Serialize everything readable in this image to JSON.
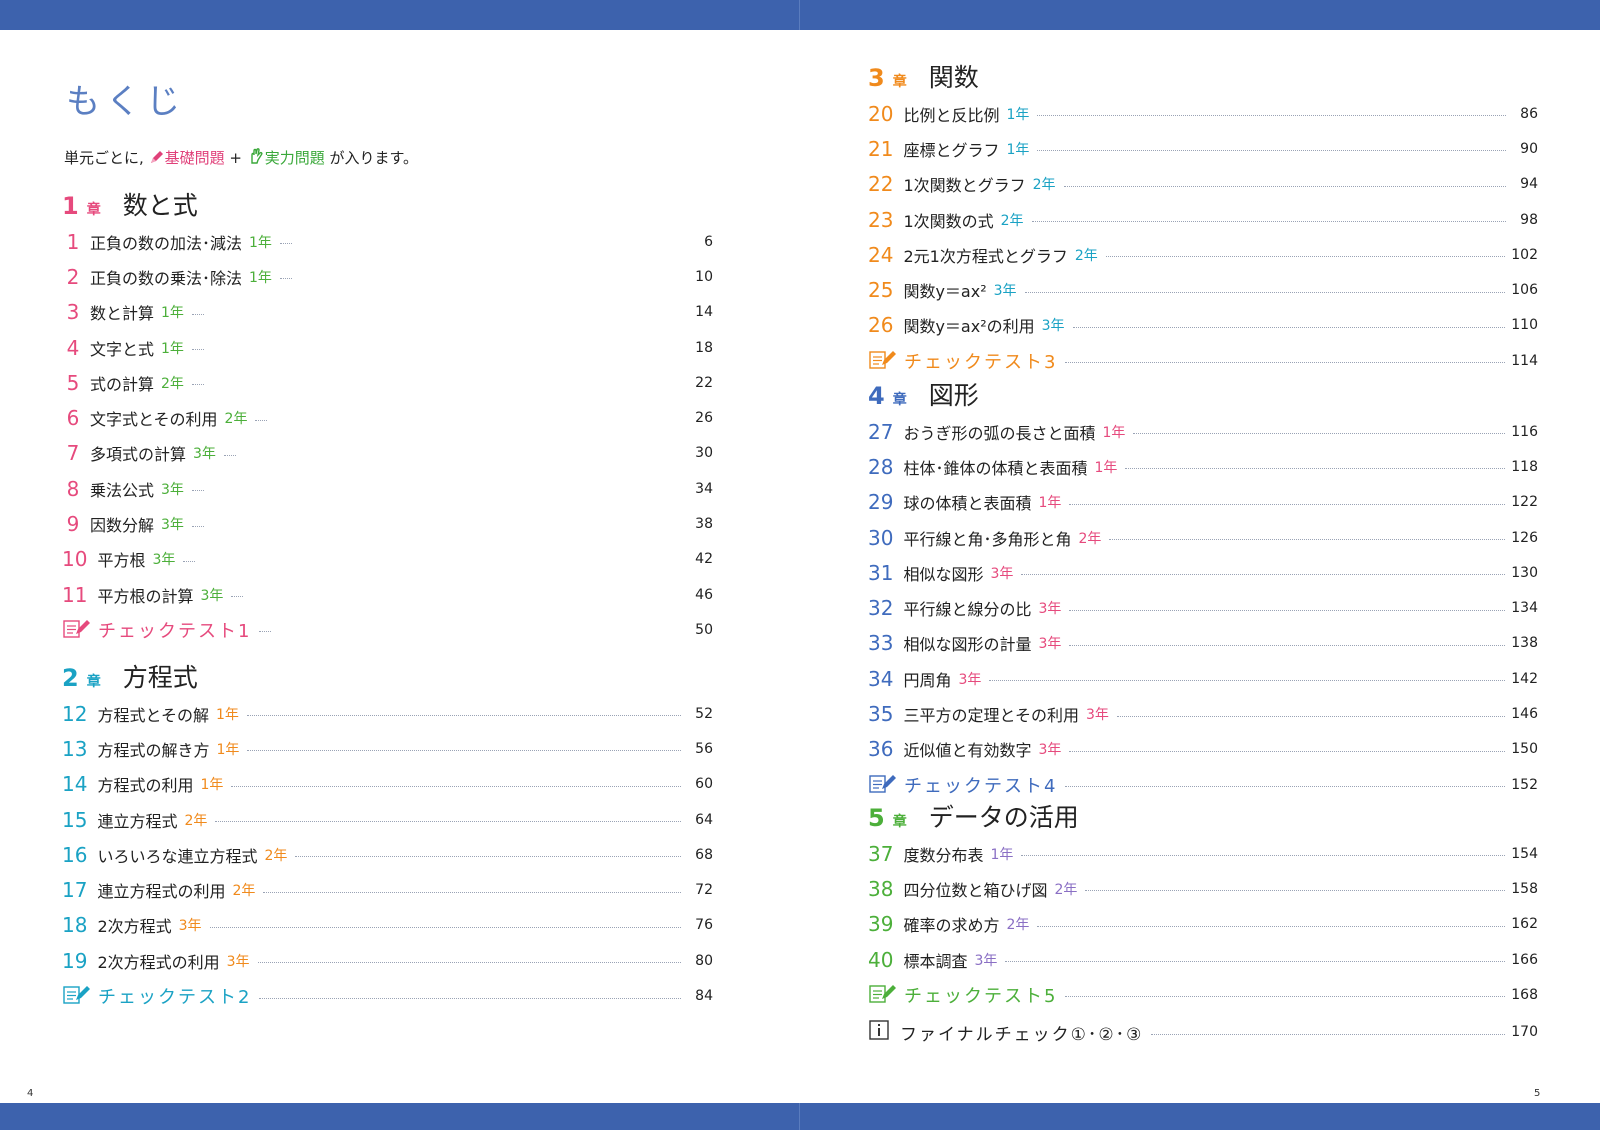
{
  "page_title": "もくじ",
  "intro": {
    "prefix": "単元ごとに,",
    "basic": "基礎問題",
    "plus": "+",
    "practical": "実力問題",
    "suffix": "が入ります。"
  },
  "chapter_mark": "章",
  "page_numbers": {
    "left": "4",
    "right": "5"
  },
  "colors": {
    "band": "#3d62ad",
    "pink": "#e64a7d",
    "teal": "#1aa2c4",
    "orange": "#f08a1c",
    "blue": "#3f6bbd",
    "green": "#4caf3a",
    "purple": "#8a6fc4",
    "grade_green": "#3aa83a"
  },
  "chapters": [
    {
      "num": "1",
      "title": "数と式",
      "items": [
        {
          "num": "1",
          "title": "正負の数の加法･減法",
          "grade": "1年",
          "page": "6"
        },
        {
          "num": "2",
          "title": "正負の数の乗法･除法",
          "grade": "1年",
          "page": "10"
        },
        {
          "num": "3",
          "title": "数と計算",
          "grade": "1年",
          "page": "14"
        },
        {
          "num": "4",
          "title": "文字と式",
          "grade": "1年",
          "page": "18"
        },
        {
          "num": "5",
          "title": "式の計算",
          "grade": "2年",
          "page": "22"
        },
        {
          "num": "6",
          "title": "文字式とその利用",
          "grade": "2年",
          "page": "26"
        },
        {
          "num": "7",
          "title": "多項式の計算",
          "grade": "3年",
          "page": "30"
        },
        {
          "num": "8",
          "title": "乗法公式",
          "grade": "3年",
          "page": "34"
        },
        {
          "num": "9",
          "title": "因数分解",
          "grade": "3年",
          "page": "38"
        },
        {
          "num": "10",
          "title": "平方根",
          "grade": "3年",
          "page": "42"
        },
        {
          "num": "11",
          "title": "平方根の計算",
          "grade": "3年",
          "page": "46"
        }
      ],
      "test": {
        "label": "チェックテスト1",
        "page": "50"
      }
    },
    {
      "num": "2",
      "title": "方程式",
      "items": [
        {
          "num": "12",
          "title": "方程式とその解",
          "grade": "1年",
          "page": "52"
        },
        {
          "num": "13",
          "title": "方程式の解き方",
          "grade": "1年",
          "page": "56"
        },
        {
          "num": "14",
          "title": "方程式の利用",
          "grade": "1年",
          "page": "60"
        },
        {
          "num": "15",
          "title": "連立方程式",
          "grade": "2年",
          "page": "64"
        },
        {
          "num": "16",
          "title": "いろいろな連立方程式",
          "grade": "2年",
          "page": "68"
        },
        {
          "num": "17",
          "title": "連立方程式の利用",
          "grade": "2年",
          "page": "72"
        },
        {
          "num": "18",
          "title": "2次方程式",
          "grade": "3年",
          "page": "76"
        },
        {
          "num": "19",
          "title": "2次方程式の利用",
          "grade": "3年",
          "page": "80"
        }
      ],
      "test": {
        "label": "チェックテスト2",
        "page": "84"
      }
    },
    {
      "num": "3",
      "title": "関数",
      "items": [
        {
          "num": "20",
          "title": "比例と反比例",
          "grade": "1年",
          "page": "86"
        },
        {
          "num": "21",
          "title": "座標とグラフ",
          "grade": "1年",
          "page": "90"
        },
        {
          "num": "22",
          "title": "1次関数とグラフ",
          "grade": "2年",
          "page": "94"
        },
        {
          "num": "23",
          "title": "1次関数の式",
          "grade": "2年",
          "page": "98"
        },
        {
          "num": "24",
          "title": "2元1次方程式とグラフ",
          "grade": "2年",
          "page": "102"
        },
        {
          "num": "25",
          "title": "関数y＝ax²",
          "grade": "3年",
          "page": "106"
        },
        {
          "num": "26",
          "title": "関数y＝ax²の利用",
          "grade": "3年",
          "page": "110"
        }
      ],
      "test": {
        "label": "チェックテスト3",
        "page": "114"
      }
    },
    {
      "num": "4",
      "title": "図形",
      "items": [
        {
          "num": "27",
          "title": "おうぎ形の弧の長さと面積",
          "grade": "1年",
          "page": "116"
        },
        {
          "num": "28",
          "title": "柱体･錐体の体積と表面積",
          "grade": "1年",
          "page": "118"
        },
        {
          "num": "29",
          "title": "球の体積と表面積",
          "grade": "1年",
          "page": "122"
        },
        {
          "num": "30",
          "title": "平行線と角･多角形と角",
          "grade": "2年",
          "page": "126"
        },
        {
          "num": "31",
          "title": "相似な図形",
          "grade": "3年",
          "page": "130"
        },
        {
          "num": "32",
          "title": "平行線と線分の比",
          "grade": "3年",
          "page": "134"
        },
        {
          "num": "33",
          "title": "相似な図形の計量",
          "grade": "3年",
          "page": "138"
        },
        {
          "num": "34",
          "title": "円周角",
          "grade": "3年",
          "page": "142"
        },
        {
          "num": "35",
          "title": "三平方の定理とその利用",
          "grade": "3年",
          "page": "146"
        },
        {
          "num": "36",
          "title": "近似値と有効数字",
          "grade": "3年",
          "page": "150"
        }
      ],
      "test": {
        "label": "チェックテスト4",
        "page": "152"
      }
    },
    {
      "num": "5",
      "title": "データの活用",
      "items": [
        {
          "num": "37",
          "title": "度数分布表",
          "grade": "1年",
          "page": "154"
        },
        {
          "num": "38",
          "title": "四分位数と箱ひげ図",
          "grade": "2年",
          "page": "158"
        },
        {
          "num": "39",
          "title": "確率の求め方",
          "grade": "2年",
          "page": "162"
        },
        {
          "num": "40",
          "title": "標本調査",
          "grade": "3年",
          "page": "166"
        }
      ],
      "test": {
        "label": "チェックテスト5",
        "page": "168"
      }
    }
  ],
  "final": {
    "label": "ファイナルチェック①･②･③",
    "page": "170"
  }
}
